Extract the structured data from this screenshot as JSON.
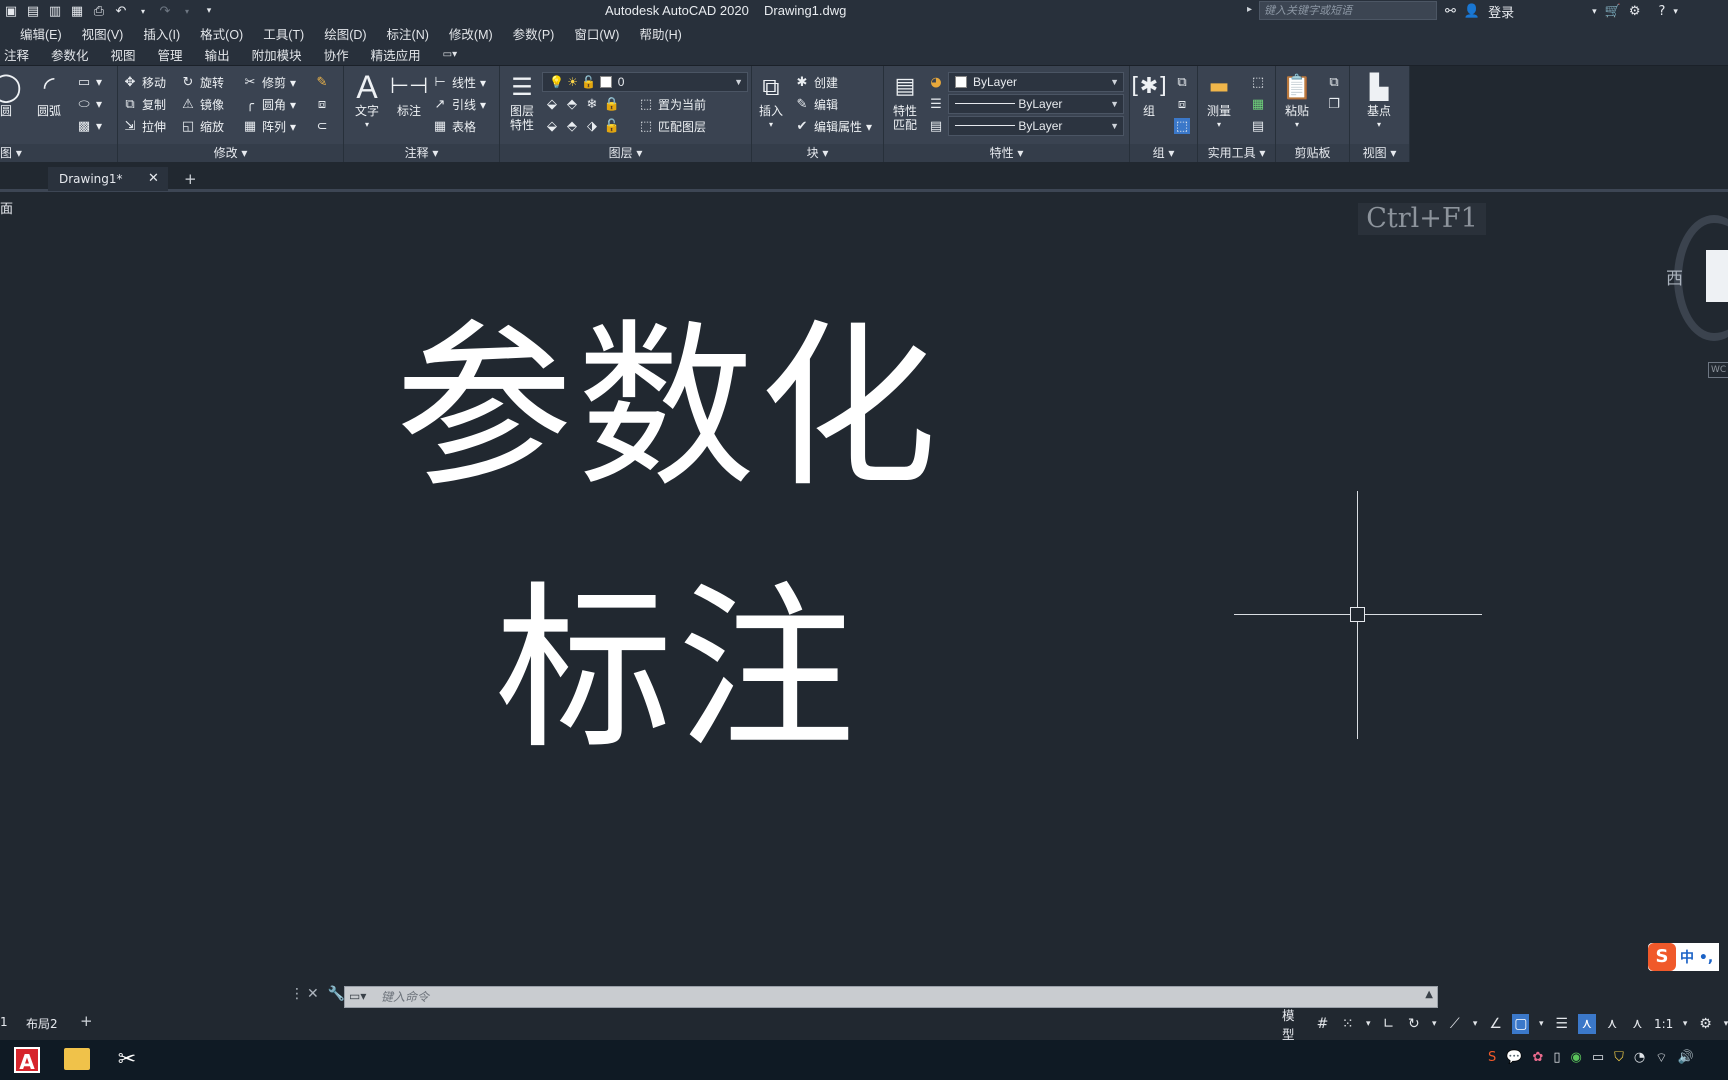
{
  "titlebar": {
    "app_title": "Autodesk AutoCAD 2020",
    "doc_title": "Drawing1.dwg",
    "search_placeholder": "键入关键字或短语",
    "login": "登录"
  },
  "menubar": {
    "items": [
      "编辑(E)",
      "视图(V)",
      "插入(I)",
      "格式(O)",
      "工具(T)",
      "绘图(D)",
      "标注(N)",
      "修改(M)",
      "参数(P)",
      "窗口(W)",
      "帮助(H)"
    ]
  },
  "ribbon_tabs": [
    "注释",
    "参数化",
    "视图",
    "管理",
    "输出",
    "附加模块",
    "协作",
    "精选应用"
  ],
  "ribbon": {
    "draw": {
      "circle": "圆",
      "arc": "圆弧",
      "title": "绘图"
    },
    "modify": {
      "move": "移动",
      "rotate": "旋转",
      "trim": "修剪",
      "copy": "复制",
      "mirror": "镜像",
      "fillet": "圆角",
      "stretch": "拉伸",
      "scale": "缩放",
      "array": "阵列",
      "title": "修改"
    },
    "annotation": {
      "text": "文字",
      "dimension": "标注",
      "linear": "线性",
      "leader": "引线",
      "table": "表格",
      "title": "注释"
    },
    "layers": {
      "layer_props_1": "图层",
      "layer_props_2": "特性",
      "current_layer": "0",
      "set_current": "置为当前",
      "match_layer": "匹配图层",
      "title": "图层"
    },
    "block": {
      "insert": "插入",
      "create": "创建",
      "edit": "编辑",
      "edit_attr": "编辑属性",
      "title": "块"
    },
    "properties": {
      "match_1": "特性",
      "match_2": "匹配",
      "color": "ByLayer",
      "linetype": "ByLayer",
      "lineweight": "ByLayer",
      "title": "特性"
    },
    "groups": {
      "group": "组",
      "title": "组"
    },
    "utilities": {
      "measure": "测量",
      "title": "实用工具"
    },
    "clipboard": {
      "paste": "粘贴",
      "title": "剪贴板"
    },
    "view": {
      "base": "基点",
      "title": "视图"
    }
  },
  "file_tabs": {
    "active": "Drawing1*"
  },
  "canvas": {
    "viewport_label": "面",
    "shortcut_hint": "Ctrl+F1",
    "line1": "参数化",
    "line2": "标注",
    "viewcube_west": "西",
    "wcs": "WC"
  },
  "command_line": {
    "placeholder": "键入命令"
  },
  "layout_tabs": {
    "tab1": "1",
    "tab2": "布局2"
  },
  "status_bar": {
    "model": "模型",
    "scale": "1:1"
  },
  "ime": {
    "text": "中 •,"
  },
  "colors": {
    "background": "#212830",
    "ribbon": "#3a4351",
    "accent": "#3b78c9"
  }
}
